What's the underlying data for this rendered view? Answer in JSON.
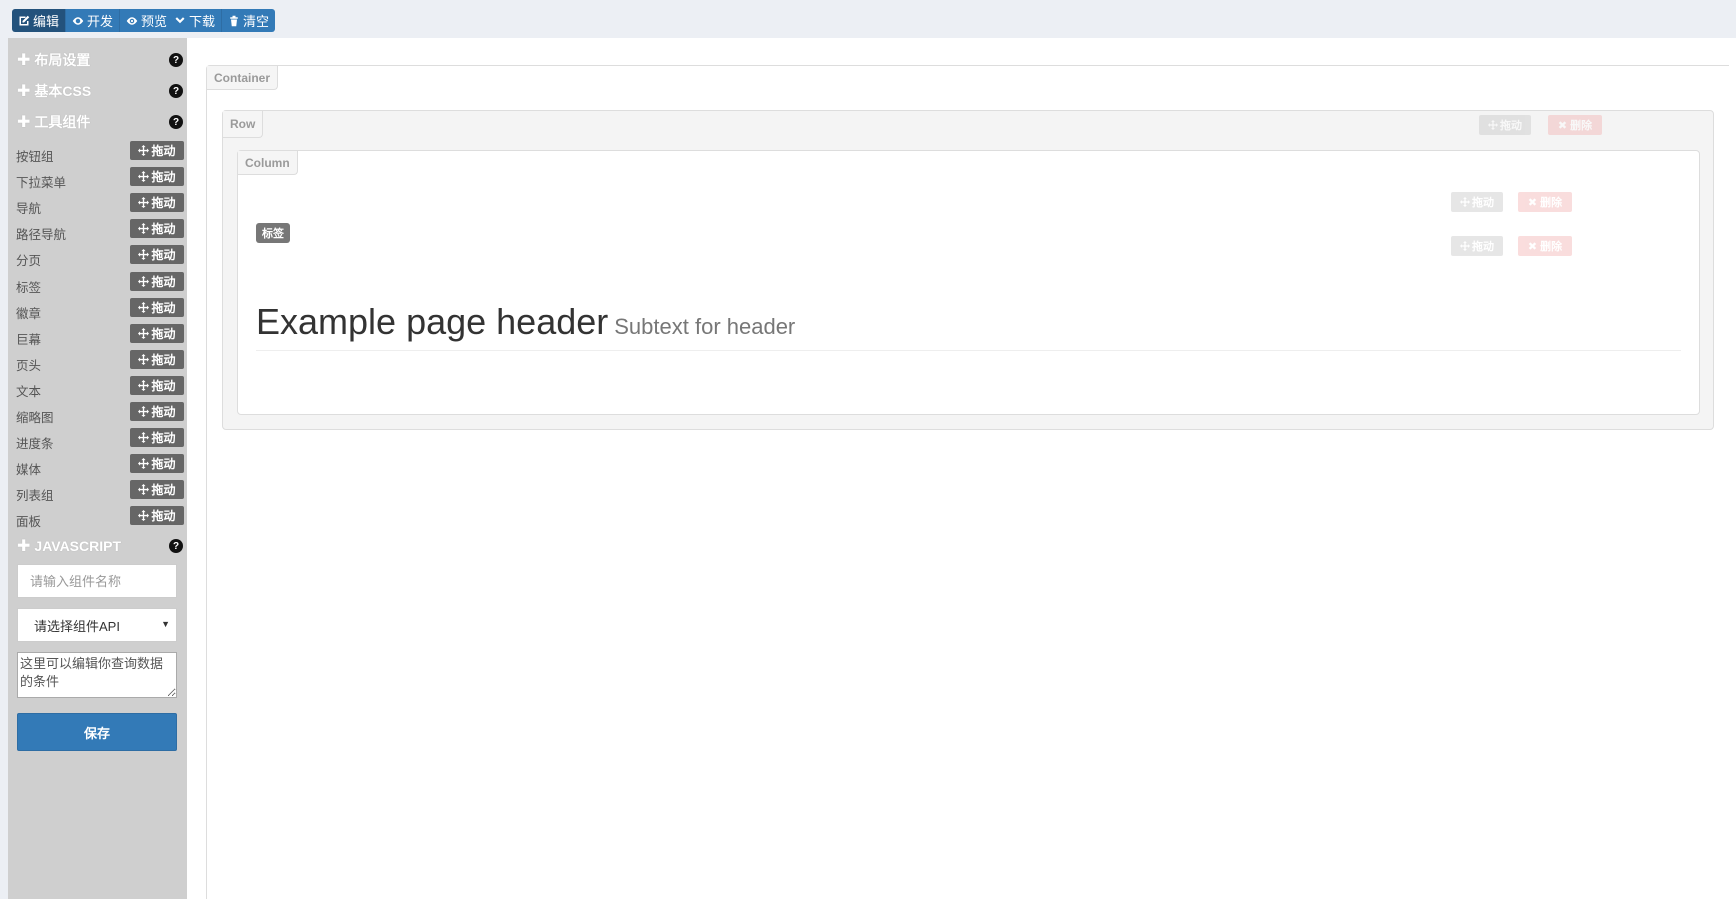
{
  "toolbar": {
    "group1": [
      {
        "label": "编辑",
        "icon": "edit-icon",
        "active": true
      },
      {
        "label": "开发",
        "icon": "code-eye-icon",
        "active": false
      },
      {
        "label": "预览",
        "icon": "eye-icon",
        "active": false
      }
    ],
    "group2": [
      {
        "label": "下载",
        "icon": "chevron-down-icon"
      },
      {
        "label": "清空",
        "icon": "trash-icon"
      }
    ]
  },
  "sidebar": {
    "sections": {
      "layout": {
        "title": "布局设置",
        "help": "?"
      },
      "css": {
        "title": "基本CSS",
        "help": "?"
      },
      "components": {
        "title": "工具组件",
        "help": "?"
      },
      "javascript": {
        "title": "JAVASCRIPT",
        "help": "?"
      }
    },
    "drag_label": "拖动",
    "components": [
      "按钮组",
      "下拉菜单",
      "导航",
      "路径导航",
      "分页",
      "标签",
      "徽章",
      "巨幕",
      "页头",
      "文本",
      "缩略图",
      "进度条",
      "媒体",
      "列表组",
      "面板"
    ],
    "search_placeholder": "请输入组件名称",
    "api_select": "请选择组件API",
    "condition_text": "这里可以编辑你查询数据的条件",
    "save_label": "保存"
  },
  "canvas": {
    "container_tag": "Container",
    "row_tag": "Row",
    "column_tag": "Column",
    "drag_label": "拖动",
    "delete_label": "删除",
    "badge_text": "标签",
    "header_title": "Example page header",
    "header_subtext": "Subtext for header"
  },
  "colors": {
    "primary": "#337ab7",
    "sidebar_bg": "#cfcfcf",
    "drag_btn": "#666666",
    "delete_ghost": "#f3b4b4"
  }
}
